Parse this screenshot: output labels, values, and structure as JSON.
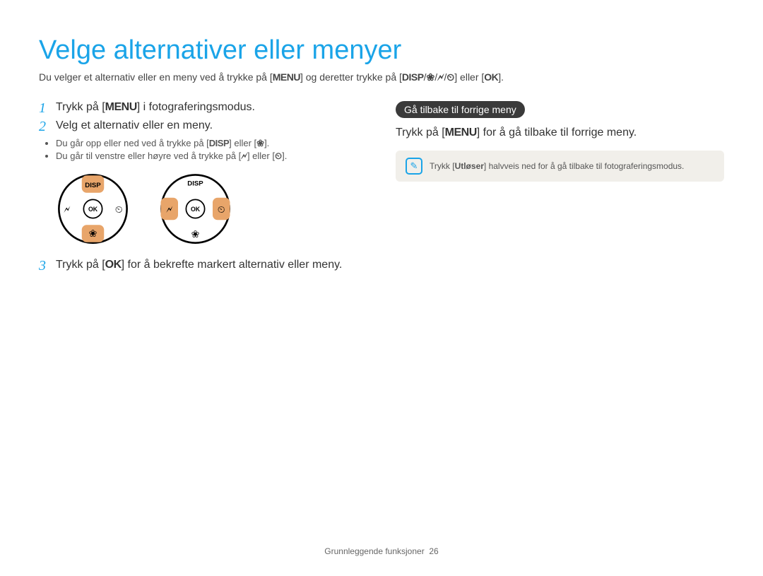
{
  "title": "Velge alternativer eller menyer",
  "intro": {
    "part1": "Du velger et alternativ eller en meny ved å trykke på [",
    "menu": "MENU",
    "part2": "] og deretter trykke på [",
    "disp": "DISP",
    "sep1": "/",
    "macro": "❀",
    "sep2": "/",
    "flash": "🗲",
    "sep3": "/",
    "timer": "⏲",
    "part3": "] eller [",
    "ok": "OK",
    "part4": "]."
  },
  "step1": {
    "num": "1",
    "pre": "Trykk på [",
    "btn": "MENU",
    "post": "] i fotograferingsmodus."
  },
  "step2": {
    "num": "2",
    "text": "Velg et alternativ eller en meny.",
    "bullet1": {
      "pre": "Du går opp eller ned ved å trykke på [",
      "a": "DISP",
      "mid": "] eller [",
      "b": "❀",
      "post": "]."
    },
    "bullet2": {
      "pre": "Du går til venstre eller høyre ved å trykke på [",
      "a": "🗲",
      "mid": "] eller [",
      "b": "⏲",
      "post": "]."
    }
  },
  "step3": {
    "num": "3",
    "pre": "Trykk på [",
    "btn": "OK",
    "post": "] for å bekrefte markert alternativ eller meny."
  },
  "right": {
    "heading": "Gå tilbake til forrige meny",
    "line_pre": "Trykk på [",
    "line_btn": "MENU",
    "line_post": "] for å gå tilbake til forrige meny.",
    "note_pre": "Trykk [",
    "note_bold": "Utløser",
    "note_post": "] halvveis ned for å gå tilbake til fotograferingsmodus."
  },
  "dial_labels": {
    "disp": "DISP",
    "ok": "OK"
  },
  "footer": {
    "text": "Grunnleggende funksjoner",
    "page": "26"
  }
}
